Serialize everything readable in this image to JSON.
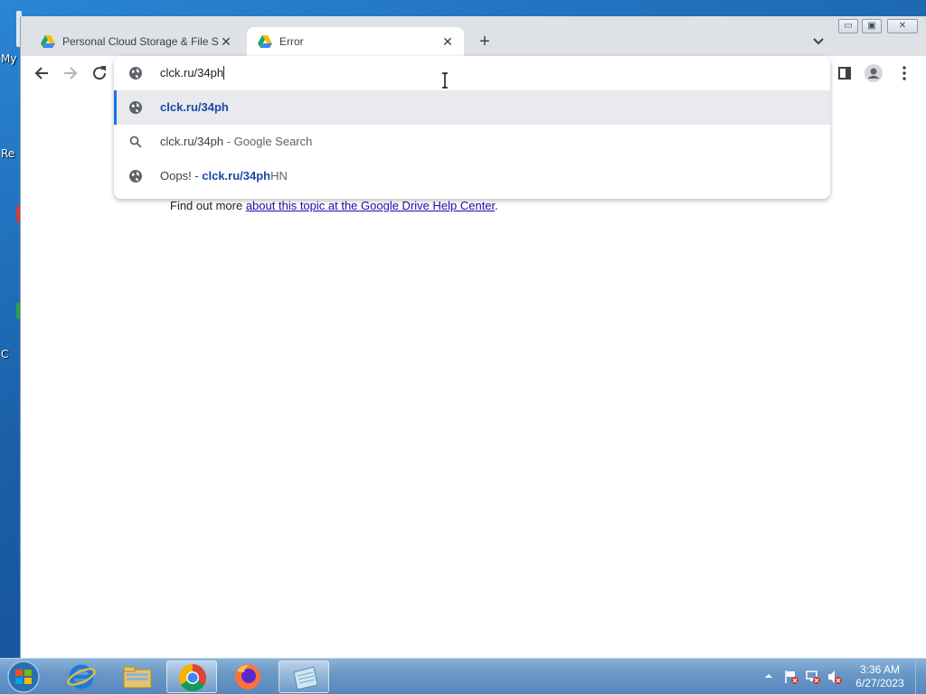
{
  "desktop": {
    "labels": [
      "My",
      "Re",
      "C"
    ]
  },
  "browser": {
    "tabs": [
      {
        "title": "Personal Cloud Storage & File Sh",
        "active": false
      },
      {
        "title": "Error",
        "active": true
      }
    ],
    "close_glyph": "✕",
    "new_tab_glyph": "+",
    "window_controls": {
      "minimize": "▭",
      "maximize": "▣",
      "close": "✕"
    }
  },
  "omnibox": {
    "input_text": "clck.ru/34ph",
    "suggestions": [
      {
        "icon": "globe-icon",
        "bold": "clck.ru/34ph",
        "rest": ""
      },
      {
        "icon": "search-icon",
        "plain": "clck.ru/34ph",
        "dim": " - Google Search"
      },
      {
        "icon": "globe-icon",
        "prefix": "Oops! - ",
        "bold": "clck.ru/34ph",
        "rest": "HN"
      }
    ]
  },
  "page": {
    "help_text": "Find out more ",
    "help_link": "about this topic at the Google Drive Help Center",
    "help_end": "."
  },
  "taskbar": {
    "apps": [
      "internet-explorer-icon",
      "file-explorer-icon",
      "chrome-icon",
      "firefox-icon",
      "notepad-icon"
    ],
    "clock_time": "3:36 AM",
    "clock_date": "6/27/2023"
  },
  "colors": {
    "accent": "#1a73e8",
    "link": "#1a0dab",
    "suggestion_bold": "#1a4aa6"
  }
}
